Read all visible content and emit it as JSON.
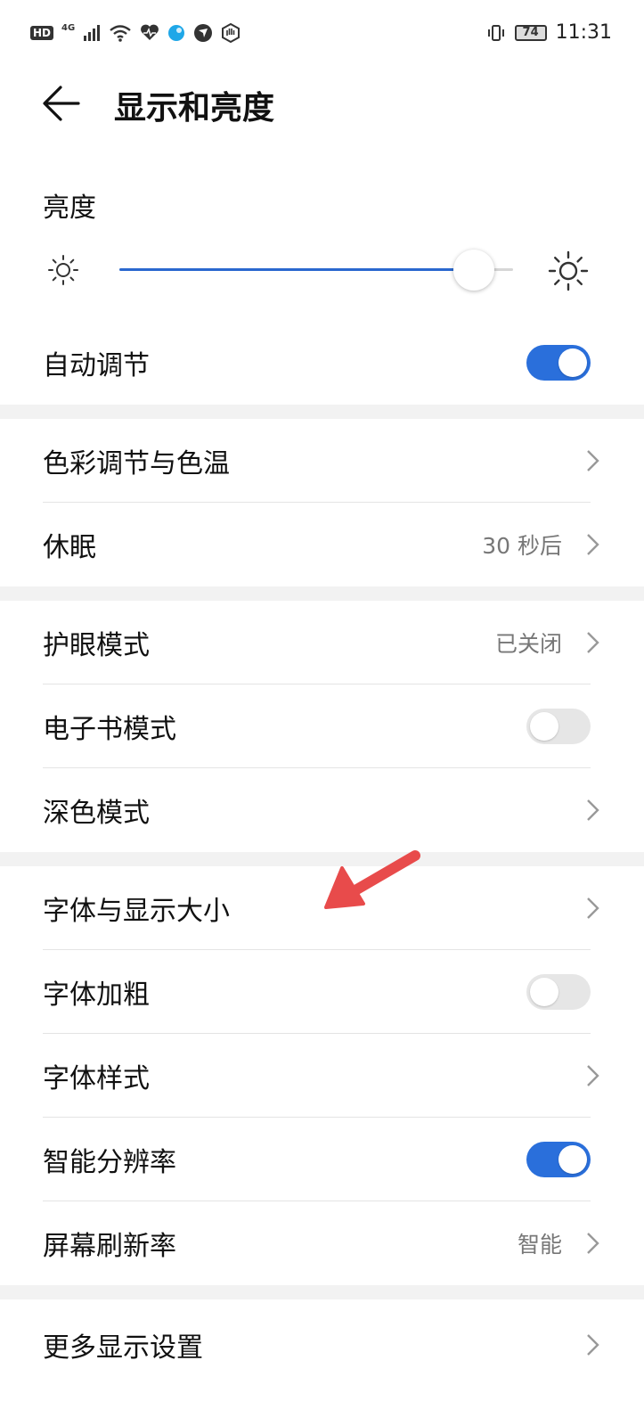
{
  "status_bar": {
    "hd": "HD",
    "network": "4G",
    "battery": "74",
    "time": "11:31"
  },
  "header": {
    "title": "显示和亮度"
  },
  "brightness": {
    "label": "亮度",
    "level": 0.9
  },
  "rows": {
    "auto_adjust": {
      "label": "自动调节",
      "on": true
    },
    "color_temp": {
      "label": "色彩调节与色温"
    },
    "sleep": {
      "label": "休眠",
      "value": "30 秒后"
    },
    "eye_comfort": {
      "label": "护眼模式",
      "value": "已关闭"
    },
    "ebook": {
      "label": "电子书模式",
      "on": false
    },
    "dark_mode": {
      "label": "深色模式"
    },
    "font_size": {
      "label": "字体与显示大小"
    },
    "bold_font": {
      "label": "字体加粗",
      "on": false
    },
    "font_style": {
      "label": "字体样式"
    },
    "smart_resolution": {
      "label": "智能分辨率",
      "on": true
    },
    "refresh_rate": {
      "label": "屏幕刷新率",
      "value": "智能"
    },
    "more_display": {
      "label": "更多显示设置"
    }
  },
  "colors": {
    "accent": "#2a6fdb",
    "annotation_arrow": "#e84b4b"
  },
  "icons": [
    "back-arrow-icon",
    "sun-small-icon",
    "sun-large-icon",
    "chevron-right-icon",
    "annotation-arrow-icon"
  ]
}
